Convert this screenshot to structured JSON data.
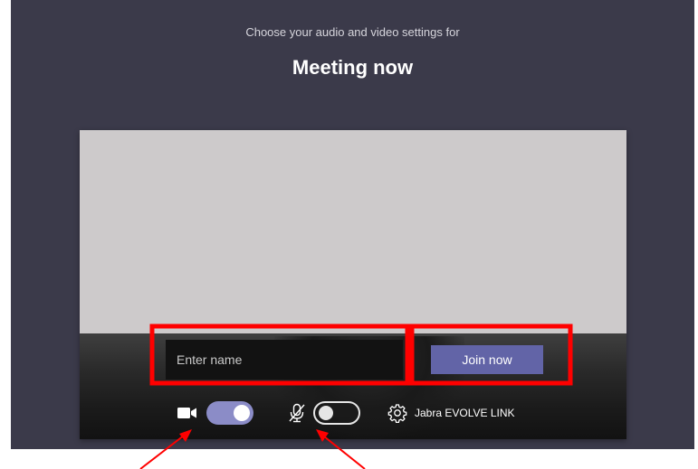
{
  "header": {
    "subtitle": "Choose your audio and video settings for",
    "meeting_title": "Meeting now"
  },
  "prejoin": {
    "name_input": {
      "value": "",
      "placeholder": "Enter name"
    },
    "join_label": "Join now"
  },
  "device_controls": {
    "camera_icon": "video-camera-icon",
    "camera_toggle_on": true,
    "mic_icon": "microphone-muted-icon",
    "mic_toggle_on": false,
    "settings_icon": "gear-icon",
    "device_name": "Jabra EVOLVE LINK"
  },
  "colors": {
    "background": "#3b3a4a",
    "accent": "#6264a7",
    "toggle_on": "#8b8cc7",
    "annotation_red": "#ff0000"
  }
}
